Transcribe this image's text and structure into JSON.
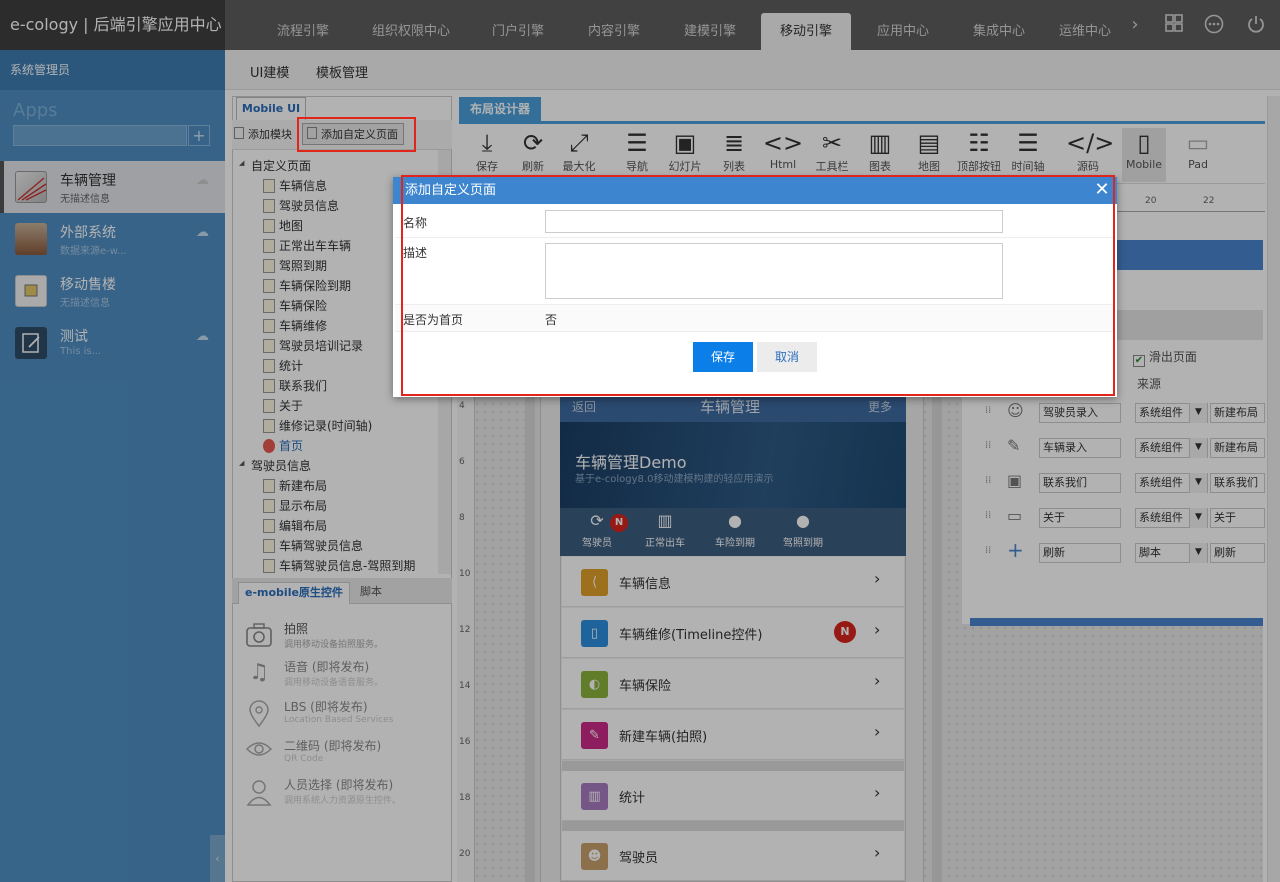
{
  "header": {
    "logo": "e-cology | 后端引擎应用中心",
    "tabs": [
      "流程引擎",
      "组织权限中心",
      "门户引擎",
      "内容引擎",
      "建模引擎",
      "移动引擎",
      "应用中心",
      "集成中心",
      "运维中心"
    ],
    "active_tab": "移动引擎",
    "icons": [
      "chevron-right-icon",
      "grid-icon",
      "more-icon",
      "power-icon"
    ]
  },
  "sidebar": {
    "user": "系统管理员",
    "apps_title": "Apps",
    "apps": [
      {
        "name": "车辆管理",
        "desc": "无描述信息"
      },
      {
        "name": "外部系统",
        "desc": "数据来源e-w..."
      },
      {
        "name": "移动售楼",
        "desc": "无描述信息"
      },
      {
        "name": "测试",
        "desc": "This is..."
      }
    ],
    "collapse_glyph": "‹"
  },
  "subnav": {
    "items": [
      "UI建模",
      "模板管理"
    ]
  },
  "left_panel": {
    "tab": "Mobile UI",
    "add_module": "添加模块",
    "add_custom_page": "添加自定义页面",
    "folder1": "自定义页面",
    "folder1_items": [
      "车辆信息",
      "驾驶员信息",
      "地图",
      "正常出车车辆",
      "驾照到期",
      "车辆保险到期",
      "车辆保险",
      "车辆维修",
      "驾驶员培训记录",
      "统计",
      "联系我们",
      "关于",
      "维修记录(时间轴)"
    ],
    "home_item": "首页",
    "folder2": "驾驶员信息",
    "folder2_items": [
      "新建布局",
      "显示布局",
      "编辑布局",
      "车辆驾驶员信息",
      "车辆驾驶员信息-驾照到期"
    ],
    "bottom_tabs": [
      "e-mobile原生控件",
      "脚本"
    ],
    "components": [
      {
        "name": "拍照",
        "desc": "调用移动设备拍照服务。"
      },
      {
        "name": "语音 (即将发布)",
        "desc": "调用移动设备语音服务。"
      },
      {
        "name": "LBS (即将发布)",
        "desc": "Location Based Services"
      },
      {
        "name": "二维码 (即将发布)",
        "desc": "QR Code"
      },
      {
        "name": "人员选择 (即将发布)",
        "desc": "调用系统人力资源原生控件。"
      }
    ]
  },
  "designer": {
    "tab": "布局设计器",
    "toolbar": [
      {
        "label": "保存",
        "icon": "download-icon"
      },
      {
        "label": "刷新",
        "icon": "refresh-icon"
      },
      {
        "label": "最大化",
        "icon": "fullscreen-icon"
      },
      {
        "label": "导航",
        "icon": "list-icon"
      },
      {
        "label": "幻灯片",
        "icon": "image-icon"
      },
      {
        "label": "列表",
        "icon": "list-lines-icon"
      },
      {
        "label": "Html",
        "icon": "code-icon"
      },
      {
        "label": "工具栏",
        "icon": "tools-icon"
      },
      {
        "label": "图表",
        "icon": "chart-icon"
      },
      {
        "label": "地图",
        "icon": "map-icon"
      },
      {
        "label": "顶部按钮",
        "icon": "top-buttons-icon"
      },
      {
        "label": "时间轴",
        "icon": "timeline-icon"
      },
      {
        "label": "源码",
        "icon": "source-icon"
      },
      {
        "label": "Mobile",
        "icon": "mobile-icon"
      },
      {
        "label": "Pad",
        "icon": "pad-icon"
      }
    ],
    "ruler_numbers": [
      "4",
      "6",
      "8",
      "10",
      "12",
      "14",
      "16",
      "18",
      "20"
    ],
    "hruler_numbers": [
      "20",
      "22"
    ]
  },
  "phone": {
    "back": "返回",
    "title": "车辆管理",
    "more": "更多",
    "banner_title": "车辆管理Demo",
    "banner_sub": "基于e-cology8.0移动建模构建的轻应用演示",
    "icons": [
      {
        "label": "驾驶员",
        "badge": "N"
      },
      {
        "label": "正常出车"
      },
      {
        "label": "车险到期"
      },
      {
        "label": "驾照到期"
      }
    ],
    "list": [
      {
        "label": "车辆信息",
        "color": "#e1a12a"
      },
      {
        "label": "车辆维修(Timeline控件)",
        "color": "#2c8fe0",
        "badge": "N"
      },
      {
        "label": "车辆保险",
        "color": "#8bb43c"
      },
      {
        "label": "新建车辆(拍照)",
        "color": "#cc2a8a"
      },
      {
        "label": "统计",
        "color": "#a97cc0"
      },
      {
        "label": "驾驶员",
        "color": "#c9a06c"
      }
    ],
    "arrow": "›"
  },
  "props": {
    "slide_out_label": "滑出页面",
    "source_header": "来源",
    "rows": [
      {
        "name": "驾驶员录入",
        "type": "系统组件",
        "target": "新建布局"
      },
      {
        "name": "车辆录入",
        "type": "系统组件",
        "target": "新建布局"
      },
      {
        "name": "联系我们",
        "type": "系统组件",
        "target": "联系我们"
      },
      {
        "name": "关于",
        "type": "系统组件",
        "target": "关于"
      },
      {
        "name": "刷新",
        "type": "脚本",
        "target": "刷新"
      }
    ]
  },
  "dialog": {
    "title": "添加自定义页面",
    "name_label": "名称",
    "desc_label": "描述",
    "home_label": "是否为首页",
    "home_value": "否",
    "save": "保存",
    "cancel": "取消",
    "close_glyph": "✕",
    "name_value": "",
    "desc_value": ""
  }
}
